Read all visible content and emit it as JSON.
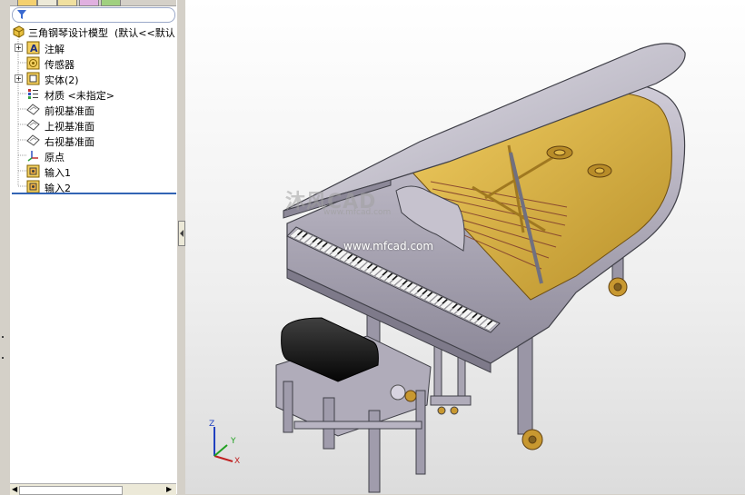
{
  "feature_tree": {
    "root": {
      "label": "三角钢琴设计模型",
      "config": "(默认<<默认"
    },
    "items": [
      {
        "label": "注解",
        "icon": "annotations-icon",
        "expandable": true
      },
      {
        "label": "传感器",
        "icon": "sensors-icon",
        "expandable": false
      },
      {
        "label": "实体(2)",
        "icon": "solid-bodies-icon",
        "expandable": true
      },
      {
        "label": "材质 <未指定>",
        "icon": "material-icon",
        "expandable": false
      },
      {
        "label": "前视基准面",
        "icon": "plane-icon",
        "expandable": false
      },
      {
        "label": "上视基准面",
        "icon": "plane-icon",
        "expandable": false
      },
      {
        "label": "右视基准面",
        "icon": "plane-icon",
        "expandable": false
      },
      {
        "label": "原点",
        "icon": "origin-icon",
        "expandable": false
      },
      {
        "label": "输入1",
        "icon": "imported-body-icon",
        "expandable": false
      },
      {
        "label": "输入2",
        "icon": "imported-body-icon",
        "expandable": false
      }
    ]
  },
  "viewport": {
    "watermark": "沐风CAD",
    "watermark_sub": "www.mfcad.com",
    "watermark_url": "www.mfcad.com",
    "triad": {
      "x": "X",
      "y": "Y",
      "z": "Z"
    }
  },
  "colors": {
    "selection_line": "#3264b4",
    "piano_body": "#c8c4d0",
    "soundboard": "#d4aa40"
  }
}
